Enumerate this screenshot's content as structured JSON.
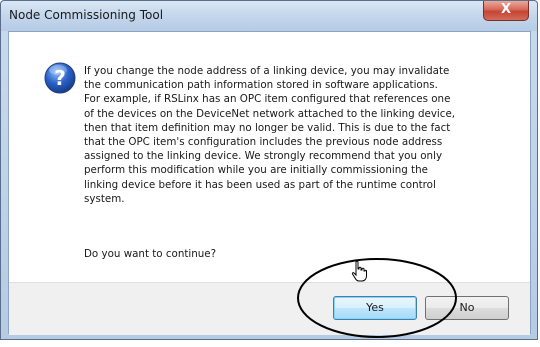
{
  "window": {
    "title": "Node Commissioning Tool",
    "close_label": "X"
  },
  "icon": "question-icon",
  "message_lines": [
    "If you change the node address of a linking device, you may invalidate",
    "the communication path information stored in software applications.",
    "For example, if RSLinx has an OPC item configured that references one",
    "of the devices on the DeviceNet network attached to the linking device,",
    "then that item definition may no longer be valid. This is due to the fact",
    "that the OPC item's configuration includes the previous node address",
    "assigned to the linking device. We strongly recommend that you only",
    "perform this modification while you are initially commissioning the",
    "linking device before it has been used as part of the runtime control",
    "system."
  ],
  "question": "Do you want to continue?",
  "buttons": {
    "yes_label": "Yes",
    "no_label": "No"
  },
  "colors": {
    "annotation_ellipse": "#000000",
    "close_button": "#c54434",
    "icon_blue": "#2b62c8"
  }
}
